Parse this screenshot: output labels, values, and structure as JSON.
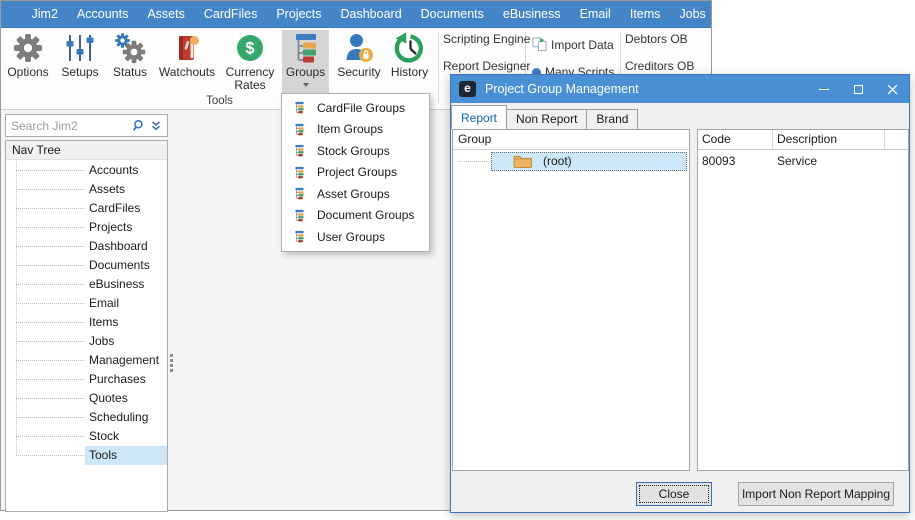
{
  "menubar": {
    "items": [
      "Jim2",
      "Accounts",
      "Assets",
      "CardFiles",
      "Projects",
      "Dashboard",
      "Documents",
      "eBusiness",
      "Email",
      "Items",
      "Jobs"
    ]
  },
  "ribbon": {
    "group_label": "Tools",
    "buttons": [
      {
        "label": "Options",
        "icon": "gear-icon"
      },
      {
        "label": "Setups",
        "icon": "sliders-icon"
      },
      {
        "label": "Status",
        "icon": "double-gear-icon"
      },
      {
        "label": "Watchouts",
        "icon": "book-icon"
      },
      {
        "label": "Currency Rates",
        "icon": "dollar-circle-icon"
      },
      {
        "label": "Groups",
        "icon": "group-tree-icon",
        "active": true
      },
      {
        "label": "Security",
        "icon": "user-lock-icon"
      },
      {
        "label": "History",
        "icon": "history-clock-icon"
      }
    ],
    "links": [
      "Scripting Engine",
      "Report Designer",
      "Import Data",
      "Many Scripts",
      "Debtors OB",
      "Creditors OB"
    ]
  },
  "groups_menu": {
    "items": [
      "CardFile Groups",
      "Item Groups",
      "Stock Groups",
      "Project Groups",
      "Asset Groups",
      "Document Groups",
      "User Groups"
    ]
  },
  "sidebar": {
    "search_placeholder": "Search Jim2",
    "nav_header": "Nav Tree",
    "items": [
      "Accounts",
      "Assets",
      "CardFiles",
      "Projects",
      "Dashboard",
      "Documents",
      "eBusiness",
      "Email",
      "Items",
      "Jobs",
      "Management",
      "Purchases",
      "Quotes",
      "Scheduling",
      "Stock",
      "Tools"
    ],
    "selected_item": "Tools"
  },
  "dialog": {
    "title": "Project Group Management",
    "tabs": [
      "Report",
      "Non Report",
      "Brand"
    ],
    "active_tab": "Report",
    "group_panel": {
      "header": "Group",
      "root_label": "(root)"
    },
    "table": {
      "columns": [
        "Code",
        "Description"
      ],
      "rows": [
        [
          "80093",
          "Service"
        ]
      ]
    },
    "buttons": {
      "close": "Close",
      "import": "Import Non Report Mapping"
    }
  },
  "icons": {
    "dollar_glyph": "$",
    "logo_glyph": "e"
  },
  "colors": {
    "menubar_blue": "#4485c7",
    "titlebar_blue": "#4a90d5",
    "selection_blue": "#cde6f8",
    "active_tab_text": "#0e62ae",
    "ribbon_active_bg": "#d5d5d5",
    "green": "#35a96b",
    "gold": "#e5ad44",
    "red": "#c23a30"
  }
}
